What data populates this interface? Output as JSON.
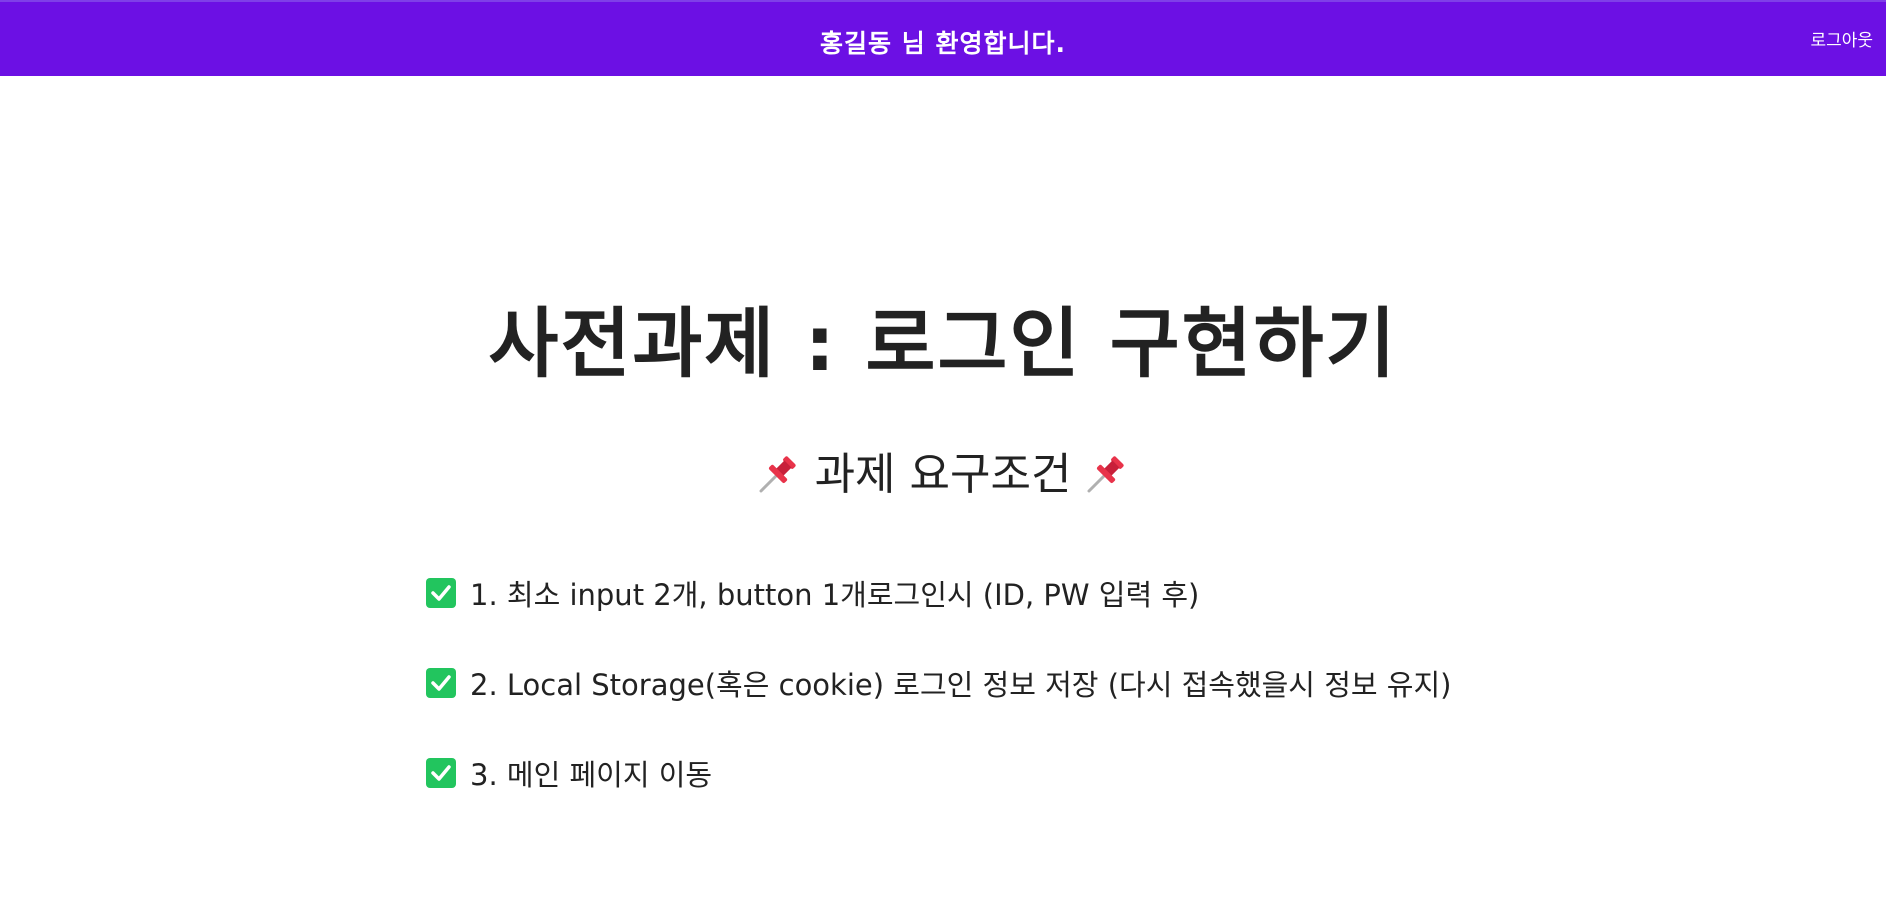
{
  "header": {
    "welcome_text": "홍길동 님 환영합니다.",
    "logout_label": "로그아웃",
    "background_color": "#6c10e4"
  },
  "main": {
    "title": "사전과제 : 로그인 구현하기",
    "subtitle": "과제 요구조건",
    "subtitle_icon": "pushpin-icon",
    "requirements": [
      {
        "icon": "check-mark-button-icon",
        "text": "1. 최소 input 2개, button 1개로그인시 (ID, PW 입력 후)"
      },
      {
        "icon": "check-mark-button-icon",
        "text": "2. Local Storage(혹은 cookie) 로그인 정보 저장 (다시 접속했을시 정보 유지)"
      },
      {
        "icon": "check-mark-button-icon",
        "text": "3. 메인 페이지 이동"
      }
    ],
    "check_color": "#22c55e"
  }
}
